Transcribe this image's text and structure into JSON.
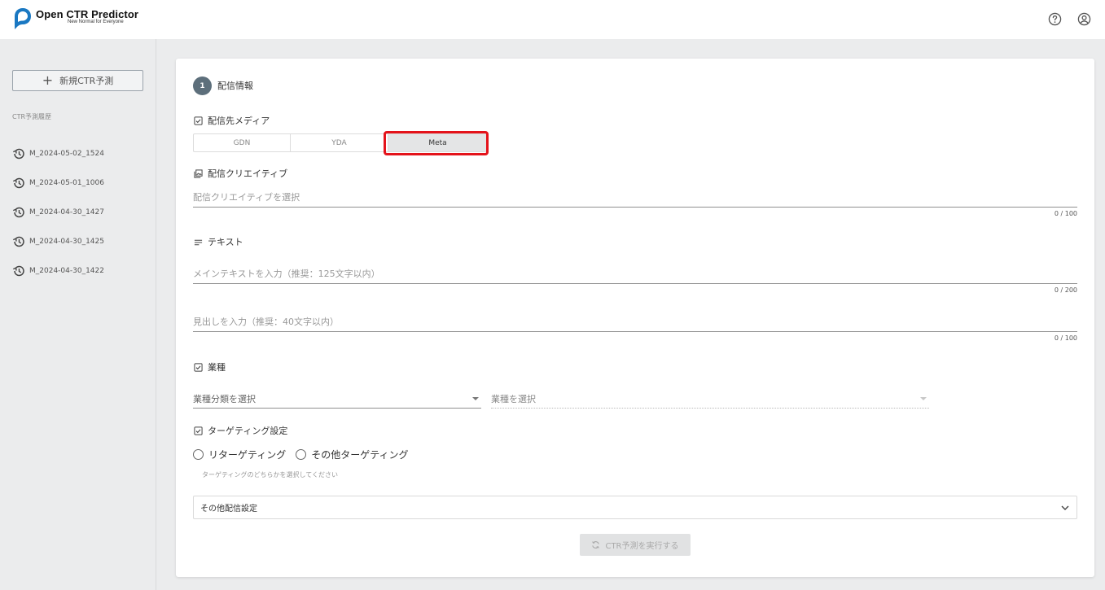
{
  "app": {
    "title": "Open CTR Predictor",
    "subtitle": "New Normal for Everyone"
  },
  "header_icons": [
    "help-icon",
    "account-icon"
  ],
  "sidebar": {
    "new_button_label": "新規CTR予測",
    "history_title": "CTR予測履歴",
    "history": [
      {
        "label": "M_2024-05-02_1524"
      },
      {
        "label": "M_2024-05-01_1006"
      },
      {
        "label": "M_2024-04-30_1427"
      },
      {
        "label": "M_2024-04-30_1425"
      },
      {
        "label": "M_2024-04-30_1422"
      }
    ]
  },
  "form": {
    "step_number": "1",
    "step_title": "配信情報",
    "media": {
      "label": "配信先メディア",
      "tabs": [
        {
          "label": "GDN"
        },
        {
          "label": "YDA"
        },
        {
          "label": "Meta"
        }
      ],
      "selected": "Meta"
    },
    "creative": {
      "label": "配信クリエイティブ",
      "placeholder": "配信クリエイティブを選択",
      "counter": "0 / 100"
    },
    "text": {
      "label": "テキスト",
      "main_placeholder": "メインテキストを入力（推奨：125文字以内）",
      "main_counter": "0 / 200",
      "headline_placeholder": "見出しを入力（推奨：40文字以内）",
      "headline_counter": "0 / 100"
    },
    "industry": {
      "label": "業種",
      "category_placeholder": "業種分類を選択",
      "industry_placeholder": "業種を選択"
    },
    "targeting": {
      "label": "ターゲティング設定",
      "options": [
        {
          "label": "リターゲティング"
        },
        {
          "label": "その他ターゲティング"
        }
      ],
      "hint": "ターゲティングのどちらかを選択してください"
    },
    "other_settings": {
      "label": "その他配信設定"
    },
    "run_button": "CTR予測を実行する"
  },
  "colors": {
    "highlight": "#e4131b",
    "step_circle": "#5d6f7b",
    "logo_blue": "#1a78c2"
  }
}
